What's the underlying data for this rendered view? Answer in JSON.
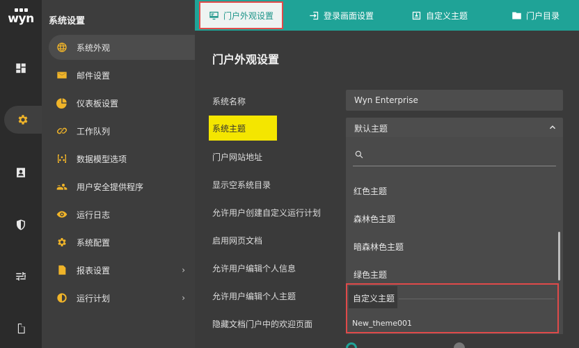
{
  "logo": {
    "text": "wyn"
  },
  "rail": {
    "items": [
      {
        "name": "dashboard-icon"
      },
      {
        "name": "gear-icon",
        "active": true
      },
      {
        "name": "contact-icon"
      },
      {
        "name": "shield-icon"
      },
      {
        "name": "sliders-icon"
      },
      {
        "name": "document-icon"
      }
    ]
  },
  "sidebar": {
    "title": "系统设置",
    "items": [
      {
        "label": "系统外观",
        "icon": "globe-icon",
        "active": true
      },
      {
        "label": "邮件设置",
        "icon": "mail-icon"
      },
      {
        "label": "仪表板设置",
        "icon": "pie-icon"
      },
      {
        "label": "工作队列",
        "icon": "link-icon"
      },
      {
        "label": "数据模型选项",
        "icon": "model-icon"
      },
      {
        "label": "用户安全提供程序",
        "icon": "users-icon"
      },
      {
        "label": "运行日志",
        "icon": "eye-icon"
      },
      {
        "label": "系统配置",
        "icon": "cog-icon"
      },
      {
        "label": "报表设置",
        "icon": "report-icon",
        "chevron": "›"
      },
      {
        "label": "运行计划",
        "icon": "clock-icon",
        "chevron": "›"
      }
    ]
  },
  "tabs": [
    {
      "label": "门户外观设置",
      "icon": "monitor-icon",
      "active": true
    },
    {
      "label": "登录画面设置",
      "icon": "login-icon"
    },
    {
      "label": "自定义主题",
      "icon": "theme-icon"
    },
    {
      "label": "门户目录",
      "icon": "folder-icon"
    }
  ],
  "main": {
    "title": "门户外观设置",
    "labels": [
      "系统名称",
      "系统主题",
      "门户网站地址",
      "显示空系统目录",
      "允许用户创建自定义运行计划",
      "启用网页文档",
      "允许用户编辑个人信息",
      "允许用户编辑个人主题",
      "隐藏文档门户中的欢迎页面"
    ],
    "system_name_value": "Wyn Enterprise",
    "theme_selected": "默认主题",
    "dropdown": {
      "search_placeholder": "",
      "options": [
        "红色主题",
        "森林色主题",
        "暗森林色主题",
        "绿色主题",
        "自定义主题",
        "New_theme001"
      ]
    }
  },
  "colors": {
    "accent": "#1fa397",
    "highlight_yellow": "#f4e600",
    "annotation_red": "#e04a4a",
    "icon_orange": "#f0b429"
  }
}
